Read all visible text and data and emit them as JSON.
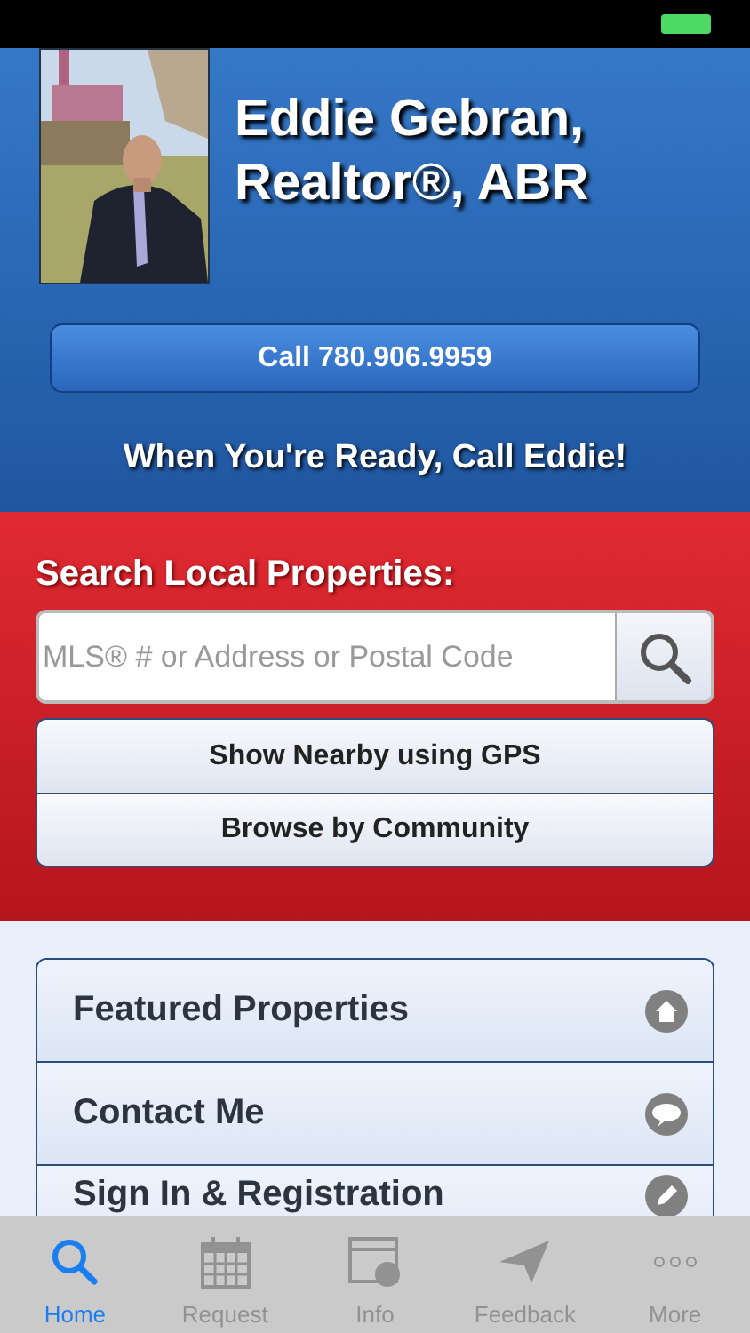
{
  "header": {
    "name": "Eddie Gebran,\nRealtor®, ABR",
    "call_button": "Call 780.906.9959",
    "tagline": "When You're Ready, Call Eddie!"
  },
  "search": {
    "title": "Search Local Properties:",
    "placeholder": "MLS® # or Address or Postal Code",
    "buttons": [
      "Show Nearby using GPS",
      "Browse by Community"
    ]
  },
  "menu": [
    {
      "label": "Featured Properties",
      "kind": "house"
    },
    {
      "label": "Contact Me",
      "kind": "chat"
    },
    {
      "label": "Sign In & Registration",
      "kind": "pencil"
    }
  ],
  "tab_bar": [
    {
      "label": "Home",
      "kind": "search",
      "selected": true
    },
    {
      "label": "Request",
      "kind": "calendar",
      "selected": false
    },
    {
      "label": "Info",
      "kind": "browser",
      "selected": false
    },
    {
      "label": "Feedback",
      "kind": "plane",
      "selected": false
    },
    {
      "label": "More",
      "kind": "more",
      "selected": false
    }
  ]
}
